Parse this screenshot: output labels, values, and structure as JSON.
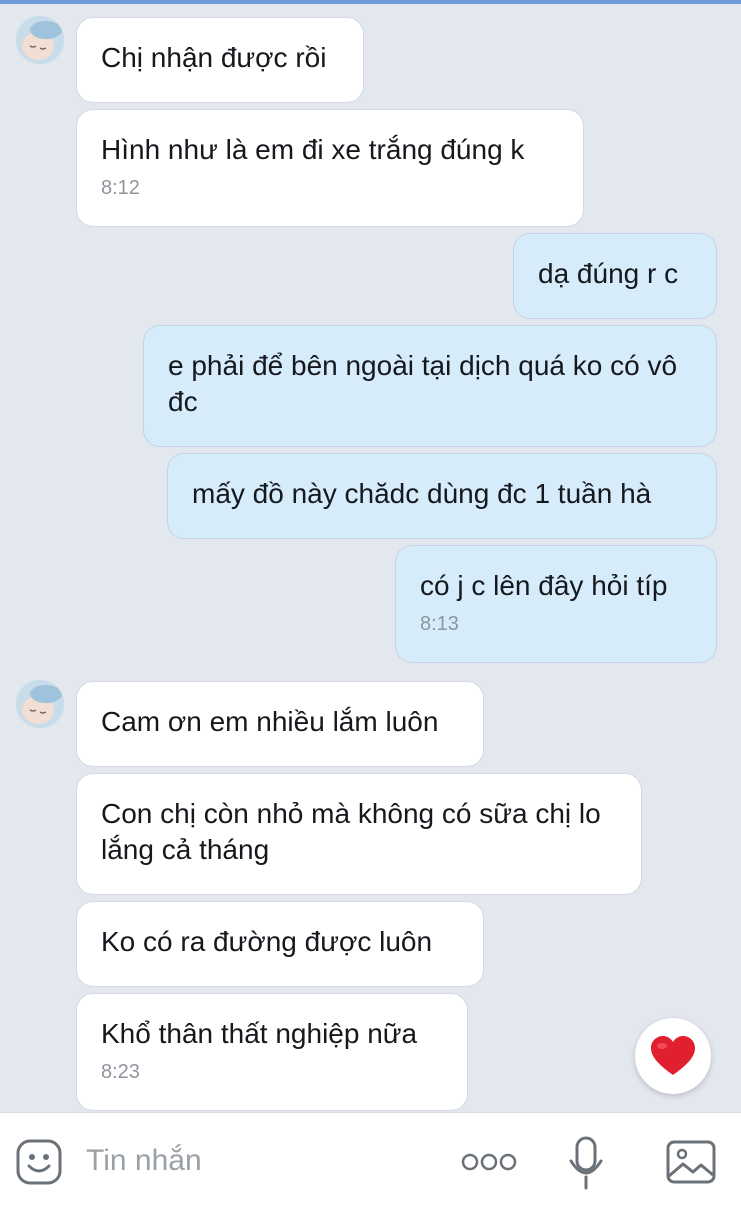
{
  "messages": [
    {
      "text": "Chị nhận được rồi"
    },
    {
      "text": "Hình như là em đi xe trắng đúng k",
      "time": "8:12"
    },
    {
      "text": "dạ đúng r c"
    },
    {
      "text": "e phải để bên ngoài tại dịch quá ko có vô đc"
    },
    {
      "text": "mấy đồ này chădc dùng đc 1 tuần hà"
    },
    {
      "text": "có j c lên đây hỏi típ",
      "time": "8:13"
    },
    {
      "text": "Cam ơn em nhiều lắm luôn"
    },
    {
      "text": "Con chị còn nhỏ mà không có sữa chị lo lắng cả tháng"
    },
    {
      "text": "Ko có ra đường được luôn"
    },
    {
      "text": "Khổ thân thất nghiệp nữa",
      "time": "8:23"
    }
  ],
  "composer": {
    "placeholder": "Tin nhắn",
    "icons": [
      "sticker-icon",
      "more-icon",
      "microphone-icon",
      "image-icon"
    ]
  },
  "reaction": {
    "icon": "heart-icon",
    "color": "#e0202e"
  },
  "colors": {
    "incoming": "#ffffff",
    "outgoing": "#d6ecfb",
    "background": "#e3e7ee"
  }
}
